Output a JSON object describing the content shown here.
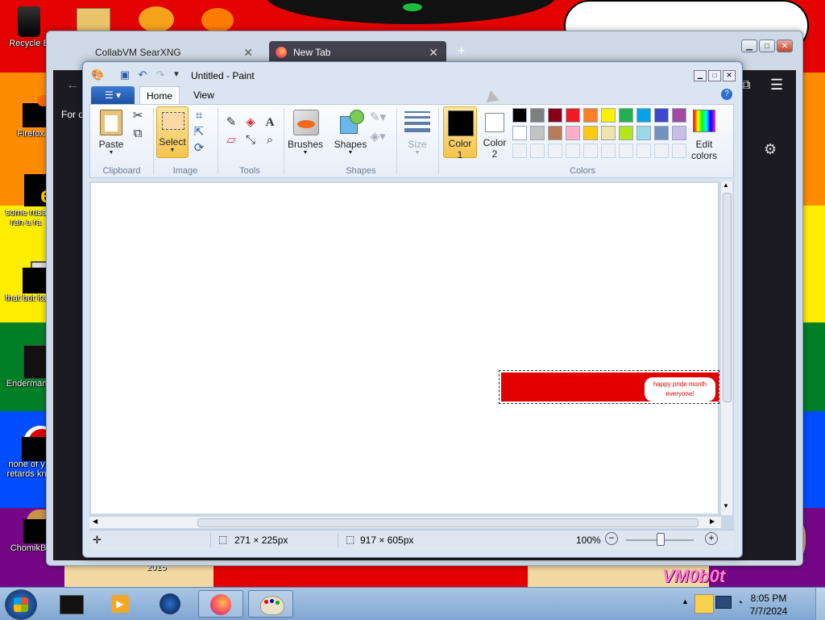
{
  "desktop": {
    "icons": [
      {
        "label": "Recycle B"
      },
      {
        "label": "Firefox"
      },
      {
        "label": "some russ"
      },
      {
        "label": "ran a ra"
      },
      {
        "label": "that but its"
      },
      {
        "label": "Enderman"
      },
      {
        "label": "none of y"
      },
      {
        "label": "retards kn"
      },
      {
        "label": "ChomikB"
      }
    ],
    "wallpaper_text": "VM0b0t",
    "wallpaper_year": "2015"
  },
  "browser": {
    "tabs": [
      {
        "label": "CollabVM SearXNG",
        "icon": "searxng-icon"
      },
      {
        "label": "New Tab",
        "icon": "firefox-icon"
      }
    ],
    "new_tab_label": "+",
    "partial_text": "For q"
  },
  "paint": {
    "title": "Untitled - Paint",
    "ribbon_tabs": [
      "Home",
      "View"
    ],
    "groups": {
      "clipboard": {
        "label": "Clipboard",
        "paste": "Paste"
      },
      "image": {
        "label": "Image",
        "select": "Select"
      },
      "tools": {
        "label": "Tools"
      },
      "shapes": {
        "label": "Shapes",
        "brushes": "Brushes",
        "shapes": "Shapes"
      },
      "size": {
        "label": "Size"
      },
      "colors": {
        "label": "Colors",
        "color1": "Color",
        "color1_num": "1",
        "color2": "Color",
        "color2_num": "2",
        "edit_colors_1": "Edit",
        "edit_colors_2": "colors",
        "palette_row1": [
          "#000000",
          "#7f7f7f",
          "#880015",
          "#ed1c24",
          "#ff7f27",
          "#fff200",
          "#22b14c",
          "#00a2e8",
          "#3f48cc",
          "#a349a4"
        ],
        "palette_row2": [
          "#ffffff",
          "#c3c3c3",
          "#b97a57",
          "#ffaec9",
          "#ffc90e",
          "#efe4b0",
          "#b5e61d",
          "#99d9ea",
          "#7092be",
          "#c8bfe7"
        ]
      }
    },
    "canvas": {
      "banner_text_line1": "happy pride month",
      "banner_text_line2": "everyone!"
    },
    "status": {
      "cursor_pos": "",
      "selection_size": "271 × 225px",
      "image_size": "917 × 605px",
      "zoom": "100%"
    }
  },
  "taskbar": {
    "time": "8:05 PM",
    "date": "7/7/2024"
  }
}
